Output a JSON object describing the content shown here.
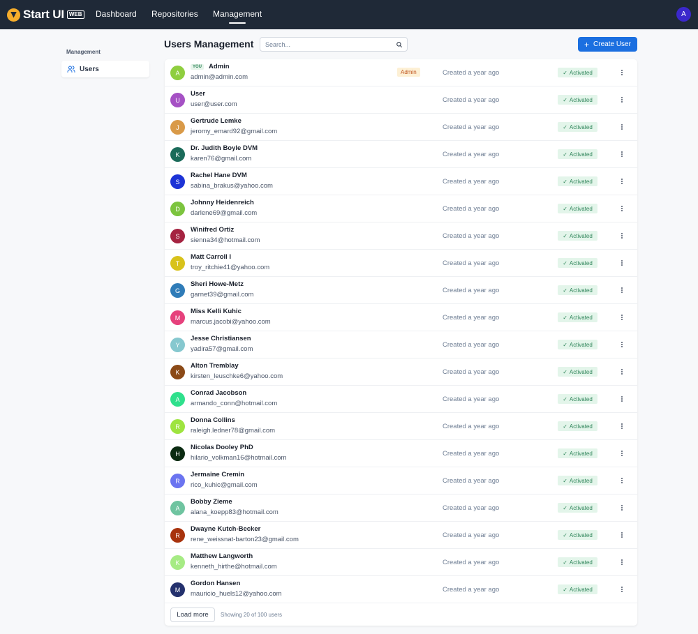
{
  "brand": {
    "name": "Start UI",
    "badge": "WEB",
    "logo_color": "#f6ad2b"
  },
  "nav": [
    {
      "label": "Dashboard",
      "active": false
    },
    {
      "label": "Repositories",
      "active": false
    },
    {
      "label": "Management",
      "active": true
    }
  ],
  "account": {
    "initial": "A",
    "color": "#3b28cc"
  },
  "sidebar": {
    "title": "Management",
    "items": [
      {
        "label": "Users",
        "icon": "users-icon",
        "active": true
      }
    ]
  },
  "header": {
    "title": "Users Management",
    "search_placeholder": "Search...",
    "search_value": "",
    "create_label": "Create User",
    "accent": "#1b6fe0"
  },
  "table": {
    "you_badge": "YOU",
    "created_text": "Created a year ago",
    "status_text": "Activated",
    "rows": [
      {
        "initial": "A",
        "color": "#8fce3f",
        "name": "Admin",
        "email": "admin@admin.com",
        "you": true,
        "role": "Admin"
      },
      {
        "initial": "U",
        "color": "#a551c4",
        "name": "User",
        "email": "user@user.com"
      },
      {
        "initial": "J",
        "color": "#d99a48",
        "name": "Gertrude Lemke",
        "email": "jeromy_emard92@gmail.com"
      },
      {
        "initial": "K",
        "color": "#1b6b5a",
        "name": "Dr. Judith Boyle DVM",
        "email": "karen76@gmail.com"
      },
      {
        "initial": "S",
        "color": "#1d33d6",
        "name": "Rachel Hane DVM",
        "email": "sabina_brakus@yahoo.com"
      },
      {
        "initial": "D",
        "color": "#7cc43e",
        "name": "Johnny Heidenreich",
        "email": "darlene69@gmail.com"
      },
      {
        "initial": "S",
        "color": "#a52341",
        "name": "Winifred Ortiz",
        "email": "sienna34@hotmail.com"
      },
      {
        "initial": "T",
        "color": "#d8c21b",
        "name": "Matt Carroll I",
        "email": "troy_ritchie41@yahoo.com"
      },
      {
        "initial": "G",
        "color": "#2f7cb8",
        "name": "Sheri Howe-Metz",
        "email": "garnet39@gmail.com"
      },
      {
        "initial": "M",
        "color": "#e6417c",
        "name": "Miss Kelli Kuhic",
        "email": "marcus.jacobi@yahoo.com"
      },
      {
        "initial": "Y",
        "color": "#86c8cf",
        "name": "Jesse Christiansen",
        "email": "yadira57@gmail.com"
      },
      {
        "initial": "K",
        "color": "#8b4a17",
        "name": "Alton Tremblay",
        "email": "kirsten_leuschke6@yahoo.com"
      },
      {
        "initial": "A",
        "color": "#2fe08c",
        "name": "Conrad Jacobson",
        "email": "armando_conn@hotmail.com"
      },
      {
        "initial": "R",
        "color": "#9ee43f",
        "name": "Donna Collins",
        "email": "raleigh.ledner78@gmail.com"
      },
      {
        "initial": "H",
        "color": "#0b2b12",
        "name": "Nicolas Dooley PhD",
        "email": "hilario_volkman16@hotmail.com"
      },
      {
        "initial": "R",
        "color": "#6b74f0",
        "name": "Jermaine Cremin",
        "email": "rico_kuhic@gmail.com"
      },
      {
        "initial": "A",
        "color": "#6fc4a0",
        "name": "Bobby Zieme",
        "email": "alana_koepp83@hotmail.com"
      },
      {
        "initial": "R",
        "color": "#a8330d",
        "name": "Dwayne Kutch-Becker",
        "email": "rene_weissnat-barton23@gmail.com"
      },
      {
        "initial": "K",
        "color": "#a6eb84",
        "name": "Matthew Langworth",
        "email": "kenneth_hirthe@hotmail.com"
      },
      {
        "initial": "M",
        "color": "#24316d",
        "name": "Gordon Hansen",
        "email": "mauricio_huels12@yahoo.com"
      }
    ]
  },
  "footer": {
    "load_more_label": "Load more",
    "showing_text": "Showing 20 of 100 users"
  }
}
